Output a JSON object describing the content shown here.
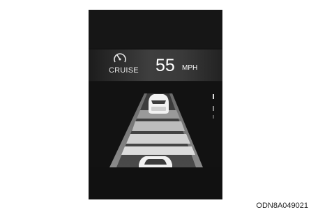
{
  "cruise": {
    "label": "CRUISE",
    "icon": "cruise-speedometer-icon",
    "speed_value": "55",
    "speed_unit": "MPH"
  },
  "road": {
    "lead_vehicle": "car-icon",
    "own_vehicle": "car-icon",
    "distance_level_indicator": "distance-level-icon"
  },
  "caption": {
    "code": "ODN8A049021"
  }
}
